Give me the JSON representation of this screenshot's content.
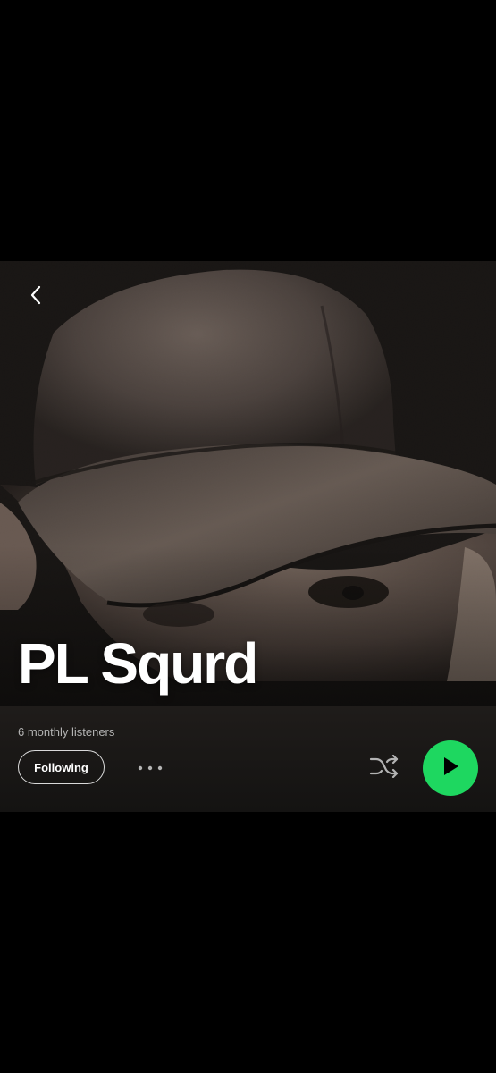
{
  "artist": {
    "name": "PL Squrd",
    "monthly_listeners": "6 monthly listeners"
  },
  "actions": {
    "follow_label": "Following"
  },
  "icons": {
    "back": "chevron-left-icon",
    "more": "more-horizontal-icon",
    "shuffle": "shuffle-icon",
    "play": "play-icon"
  },
  "colors": {
    "background": "#000000",
    "panel": "#1a1817",
    "accent_green": "#1ed760",
    "text_primary": "#ffffff",
    "text_secondary": "#b3b3b3"
  }
}
